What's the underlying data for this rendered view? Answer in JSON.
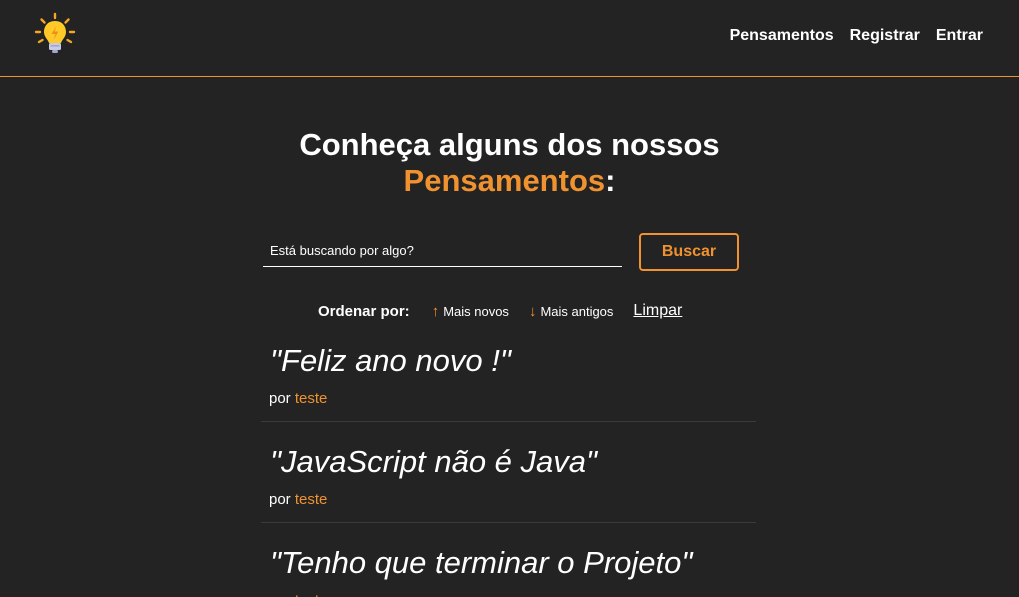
{
  "nav": {
    "logo_icon": "lightbulb-icon",
    "links": [
      "Pensamentos",
      "Registrar",
      "Entrar"
    ]
  },
  "heading": {
    "line1": "Conheça alguns dos nossos",
    "highlight": "Pensamentos",
    "suffix": ":"
  },
  "search": {
    "placeholder": "Está buscando por algo?",
    "value": "",
    "button_label": "Buscar"
  },
  "order": {
    "label": "Ordenar por:",
    "newest": {
      "icon": "arrow-up-icon",
      "label": "Mais novos"
    },
    "oldest": {
      "icon": "arrow-down-icon",
      "label": "Mais antigos"
    },
    "clear": "Limpar"
  },
  "thoughts": [
    {
      "quote": "\"Feliz ano novo !\"",
      "by": "por",
      "author": "teste"
    },
    {
      "quote": "\"JavaScript não é Java\"",
      "by": "por",
      "author": "teste"
    },
    {
      "quote": "\"Tenho que terminar o Projeto\"",
      "by": "por",
      "author": "teste"
    }
  ],
  "colors": {
    "background": "#232323",
    "accent": "#f0922f",
    "text": "#ffffff"
  }
}
